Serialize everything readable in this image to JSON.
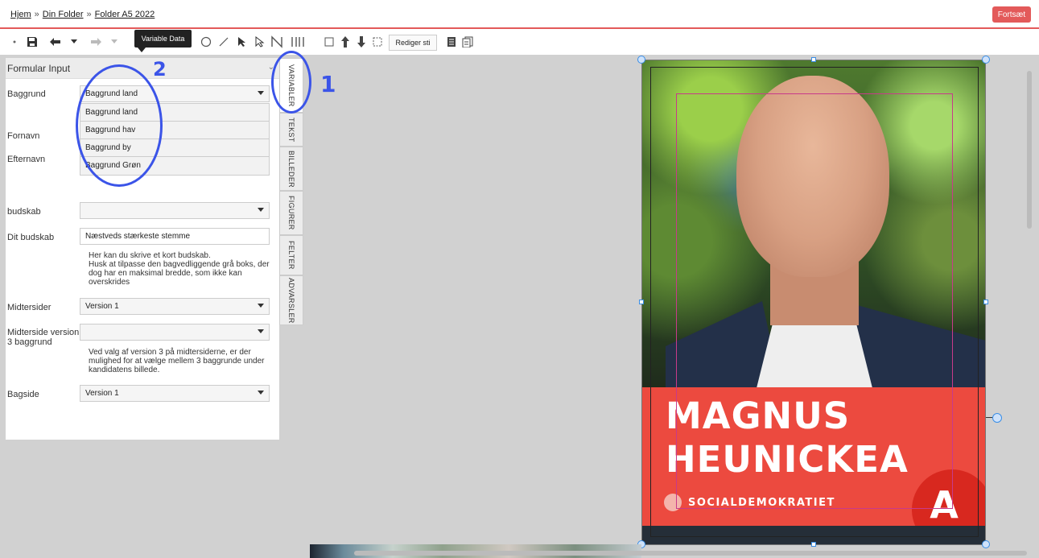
{
  "breadcrumb": {
    "home": "Hjem",
    "sep": "»",
    "folder": "Din Folder",
    "document": "Folder A5 2022"
  },
  "header": {
    "continue_label": "Fortsæt"
  },
  "toolbar": {
    "tooltip": "Variable Data",
    "edit_path_label": "Rediger sti"
  },
  "panel": {
    "title": "Formular Input"
  },
  "form": {
    "baggrund_label": "Baggrund",
    "baggrund_value": "Baggrund land",
    "baggrund_options": [
      "Baggrund land",
      "Baggrund hav",
      "Baggrund by",
      "Baggrund Grøn"
    ],
    "fornavn_label": "Fornavn",
    "efternavn_label": "Efternavn",
    "budskab_label": "budskab",
    "budskab_value": "",
    "dit_budskab_label": "Dit budskab",
    "dit_budskab_value": "Næstveds stærkeste stemme",
    "dit_budskab_help_1": "Her kan du skrive et kort budskab.",
    "dit_budskab_help_2": "Husk at tilpasse den bagvedliggende grå boks, der dog har en maksimal bredde, som ikke kan overskrides",
    "midtersider_label": "Midtersider",
    "midtersider_value": "Version 1",
    "midterside_v3_label": "Midterside version 3 baggrund",
    "midterside_v3_value": "",
    "midterside_v3_help": "Ved valg af version 3 på midtersiderne, er der mulighed for at vælge mellem 3 baggrunde under kandidatens billede.",
    "bagside_label": "Bagside",
    "bagside_value": "Version 1"
  },
  "tabs": [
    "VARIABLER",
    "TEKST",
    "BILLEDER",
    "FIGURER",
    "FELTER",
    "ADVARSLER"
  ],
  "poster": {
    "first_name": "MAGNUS",
    "last_name": "HEUNICKEA",
    "party": "SOCIALDEMOKRATIET",
    "logo_letter": "A"
  },
  "annotations": {
    "one": "1",
    "two": "2"
  },
  "colors": {
    "accent": "#e35a5a",
    "poster_red": "#ec4a3f",
    "annotation_blue": "#3b54e8"
  }
}
